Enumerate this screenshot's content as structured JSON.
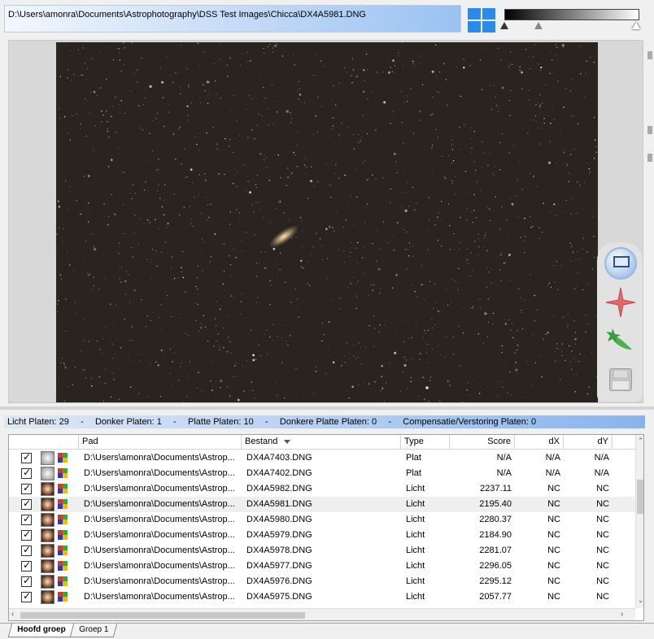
{
  "file_path": "D:\\Users\\amonra\\Documents\\Astrophotography\\DSS Test Images\\Chicca\\DX4A5981.DNG",
  "icons": {
    "view_mode": "four-pane-icon",
    "tools": [
      "selection-rectangle-icon",
      "star-edit-icon",
      "comet-edit-icon",
      "save-icon"
    ]
  },
  "counts": {
    "licht": "Licht Platen: 29",
    "donker": "Donker Platen:  1",
    "platte": "Platte Platen: 10",
    "donkere_platte": "Donkere Platte Platen:  0",
    "compensatie": "Compensatie/Verstoring Platen:  0",
    "separator": "-"
  },
  "table": {
    "headers": {
      "pad": "Pad",
      "bestand": "Bestand",
      "type": "Type",
      "score": "Score",
      "dx": "dX",
      "dy": "dY"
    },
    "rows": [
      {
        "pad": "D:\\Users\\amonra\\Documents\\Astrop...",
        "bestand": "DX4A7403.DNG",
        "type": "Plat",
        "score": "N/A",
        "dx": "N/A",
        "dy": "N/A",
        "kind": "flat"
      },
      {
        "pad": "D:\\Users\\amonra\\Documents\\Astrop...",
        "bestand": "DX4A7402.DNG",
        "type": "Plat",
        "score": "N/A",
        "dx": "N/A",
        "dy": "N/A",
        "kind": "flat"
      },
      {
        "pad": "D:\\Users\\amonra\\Documents\\Astrop...",
        "bestand": "DX4A5982.DNG",
        "type": "Licht",
        "score": "2237.11",
        "dx": "NC",
        "dy": "NC",
        "kind": "light"
      },
      {
        "pad": "D:\\Users\\amonra\\Documents\\Astrop...",
        "bestand": "DX4A5981.DNG",
        "type": "Licht",
        "score": "2195.40",
        "dx": "NC",
        "dy": "NC",
        "kind": "light"
      },
      {
        "pad": "D:\\Users\\amonra\\Documents\\Astrop...",
        "bestand": "DX4A5980.DNG",
        "type": "Licht",
        "score": "2280.37",
        "dx": "NC",
        "dy": "NC",
        "kind": "light"
      },
      {
        "pad": "D:\\Users\\amonra\\Documents\\Astrop...",
        "bestand": "DX4A5979.DNG",
        "type": "Licht",
        "score": "2184.90",
        "dx": "NC",
        "dy": "NC",
        "kind": "light"
      },
      {
        "pad": "D:\\Users\\amonra\\Documents\\Astrop...",
        "bestand": "DX4A5978.DNG",
        "type": "Licht",
        "score": "2281.07",
        "dx": "NC",
        "dy": "NC",
        "kind": "light"
      },
      {
        "pad": "D:\\Users\\amonra\\Documents\\Astrop...",
        "bestand": "DX4A5977.DNG",
        "type": "Licht",
        "score": "2296.05",
        "dx": "NC",
        "dy": "NC",
        "kind": "light"
      },
      {
        "pad": "D:\\Users\\amonra\\Documents\\Astrop...",
        "bestand": "DX4A5976.DNG",
        "type": "Licht",
        "score": "2295.12",
        "dx": "NC",
        "dy": "NC",
        "kind": "light"
      },
      {
        "pad": "D:\\Users\\amonra\\Documents\\Astrop...",
        "bestand": "DX4A5975.DNG",
        "type": "Licht",
        "score": "2057.77",
        "dx": "NC",
        "dy": "NC",
        "kind": "light"
      }
    ],
    "selected_row": 3
  },
  "tabs": [
    {
      "label": "Hoofd groep",
      "active": true
    },
    {
      "label": "Groep 1",
      "active": false
    }
  ],
  "colors": {
    "accent": "#2a8be8",
    "sky": "#2a2421"
  }
}
